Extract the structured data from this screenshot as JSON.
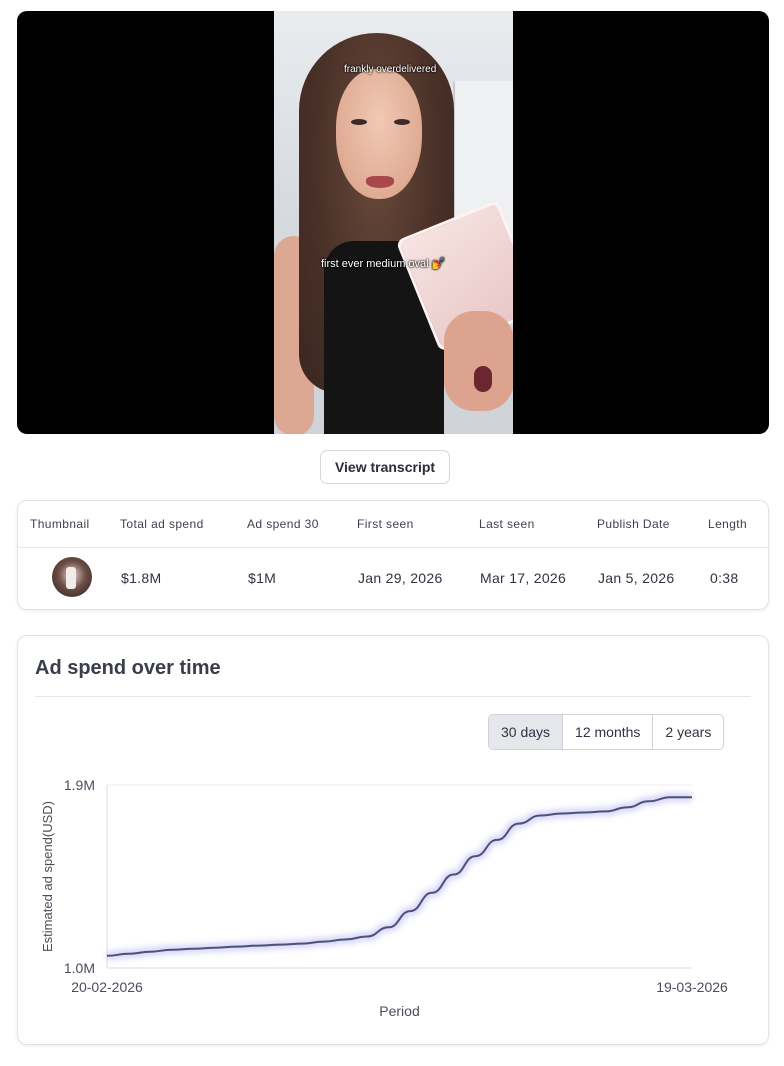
{
  "video": {
    "caption_top": "frankly overdelivered",
    "caption_mid": "first ever medium oval 💅"
  },
  "transcript_button": "View transcript",
  "stats": {
    "headers": [
      "Thumbnail",
      "Total ad spend",
      "Ad spend 30",
      "First seen",
      "Last seen",
      "Publish Date",
      "Length"
    ],
    "total_ad_spend": "$1.8M",
    "ad_spend_30": "$1M",
    "first_seen": "Jan 29, 2026",
    "last_seen": "Mar 17, 2026",
    "publish_date": "Jan 5, 2026",
    "length": "0:38"
  },
  "chart": {
    "title": "Ad spend over time",
    "ranges": [
      "30 days",
      "12 months",
      "2 years"
    ],
    "selected_range": "30 days"
  },
  "chart_data": {
    "type": "line",
    "ylabel": "Estimated ad spend(USD)",
    "xlabel": "Period",
    "x_tick_labels": [
      "20-02-2026",
      "19-03-2026"
    ],
    "y_tick_labels": [
      "1.9M",
      "1.0M"
    ],
    "ylim": [
      1.0,
      1.9
    ],
    "y_unit": "M USD",
    "x_start": "20-02-2026",
    "x_end": "19-03-2026",
    "series": [
      {
        "color": "#4f4f7a",
        "values": [
          1.06,
          1.07,
          1.08,
          1.09,
          1.095,
          1.1,
          1.105,
          1.11,
          1.115,
          1.12,
          1.13,
          1.14,
          1.155,
          1.2,
          1.28,
          1.37,
          1.46,
          1.55,
          1.63,
          1.71,
          1.75,
          1.76,
          1.765,
          1.77,
          1.79,
          1.82,
          1.84,
          1.84
        ]
      }
    ],
    "grid": false
  }
}
